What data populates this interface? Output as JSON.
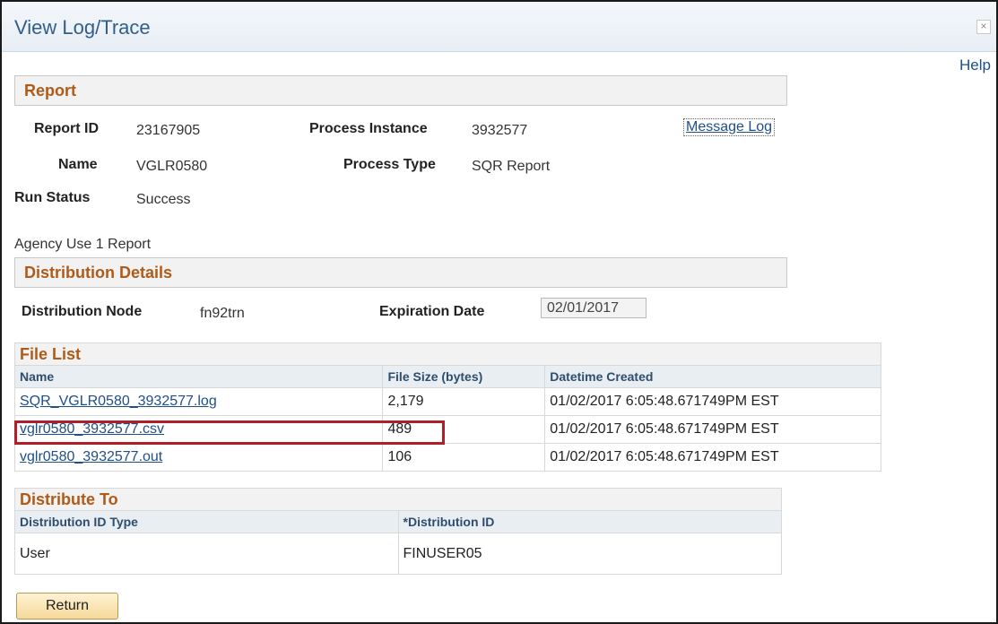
{
  "window": {
    "title": "View Log/Trace",
    "close_glyph": "×",
    "help_label": "Help"
  },
  "report": {
    "header": "Report",
    "report_id_label": "Report ID",
    "report_id": "23167905",
    "process_instance_label": "Process Instance",
    "process_instance": "3932577",
    "message_log_label": "Message Log",
    "name_label": "Name",
    "name": "VGLR0580",
    "process_type_label": "Process Type",
    "process_type": "SQR Report",
    "run_status_label": "Run Status",
    "run_status": "Success",
    "description": "Agency Use 1 Report"
  },
  "distribution_details": {
    "header": "Distribution Details",
    "node_label": "Distribution Node",
    "node": "fn92trn",
    "expiration_label": "Expiration Date",
    "expiration_date": "02/01/2017"
  },
  "file_list": {
    "header": "File List",
    "columns": [
      "Name",
      "File Size (bytes)",
      "Datetime Created"
    ],
    "rows": [
      {
        "name": "SQR_VGLR0580_3932577.log",
        "size": "2,179",
        "created": "01/02/2017  6:05:48.671749PM EST"
      },
      {
        "name": "vglr0580_3932577.csv",
        "size": "489",
        "created": "01/02/2017  6:05:48.671749PM EST"
      },
      {
        "name": "vglr0580_3932577.out",
        "size": "106",
        "created": "01/02/2017  6:05:48.671749PM EST"
      }
    ]
  },
  "distribute_to": {
    "header": "Distribute To",
    "columns": [
      "Distribution ID Type",
      "*Distribution ID"
    ],
    "rows": [
      {
        "type": "User",
        "id": "FINUSER05"
      }
    ]
  },
  "return_label": "Return",
  "colors": {
    "accent_link": "#1f4e8c",
    "section_title": "#b05a18",
    "highlight": "#b01e2a",
    "button": "#f6d99a"
  }
}
